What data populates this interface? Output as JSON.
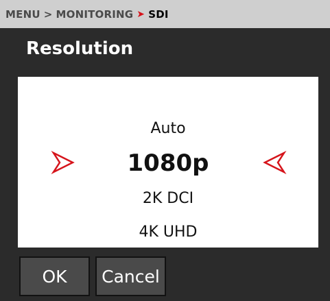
{
  "breadcrumb": {
    "items": [
      "MENU",
      "MONITORING",
      "SDI"
    ]
  },
  "title": "Resolution",
  "options": {
    "above": "Auto",
    "selected": "1080p",
    "below": [
      "2K DCI",
      "4K UHD"
    ]
  },
  "buttons": {
    "ok_label": "OK",
    "cancel_label": "Cancel"
  },
  "colors": {
    "accent": "#d6141b",
    "breadcrumb_bg": "#cfcfcf",
    "background": "#2b2b2b"
  },
  "icons": {
    "prev": "arrow-left-icon",
    "next": "arrow-right-icon"
  }
}
